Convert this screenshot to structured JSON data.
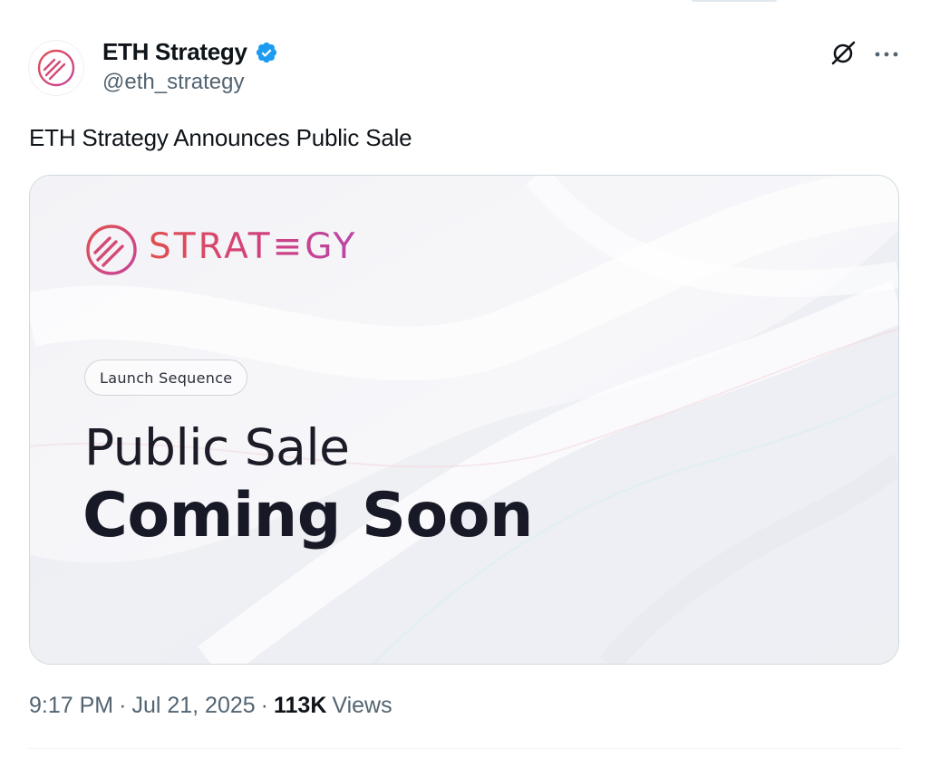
{
  "author": {
    "name": "ETH Strategy",
    "handle": "@eth_strategy",
    "verified": true,
    "avatar_icon": "strategy-logo-icon"
  },
  "actions": {
    "grok_icon": "grok-icon",
    "more_icon": "more-icon"
  },
  "tweet": {
    "text": "ETH Strategy Announces Public Sale"
  },
  "media": {
    "brand_word": "STRAT≡GY",
    "pill_label": "Launch Sequence",
    "headline_line1": "Public Sale",
    "headline_line2": "Coming Soon"
  },
  "meta": {
    "time": "9:17 PM",
    "date": "Jul 21, 2025",
    "separator": "·",
    "views_count": "113K",
    "views_label": "Views"
  },
  "colors": {
    "text_primary": "#0f1419",
    "text_secondary": "#536471",
    "verified_blue": "#1d9bf0",
    "brand_red": "#e0504f",
    "brand_pink": "#d1407e",
    "brand_purple": "#b947a6"
  }
}
